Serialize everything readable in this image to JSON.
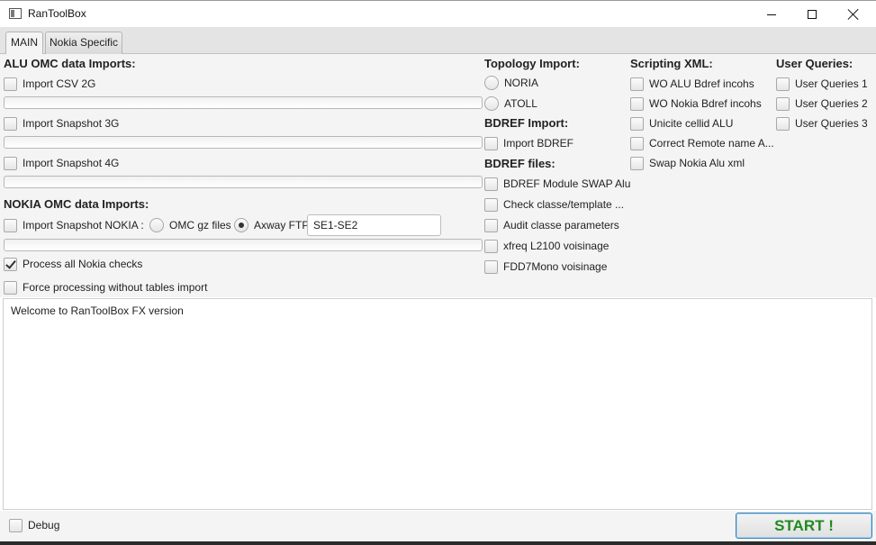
{
  "window": {
    "title": "RanToolBox"
  },
  "tabs": [
    {
      "label": "MAIN",
      "selected": true
    },
    {
      "label": "Nokia Specific",
      "selected": false
    }
  ],
  "alu": {
    "heading": "ALU OMC data Imports:",
    "items": [
      {
        "label": "Import CSV 2G",
        "checked": false,
        "progress": 0
      },
      {
        "label": "Import Snapshot 3G",
        "checked": false,
        "progress": 0
      },
      {
        "label": "Import Snapshot 4G",
        "checked": false,
        "progress": 0
      }
    ]
  },
  "nokia": {
    "heading": "NOKIA OMC data Imports:",
    "snapshot_label": "Import Snapshot NOKIA :",
    "snapshot_checked": false,
    "radio_omc_label": "OMC gz files",
    "radio_omc_selected": false,
    "radio_axway_label": "Axway FTP",
    "radio_axway_selected": true,
    "ftp_value": "SE1-SE2",
    "progress": 0,
    "process_all_label": "Process all Nokia checks",
    "process_all_checked": true,
    "force_label": "Force processing without tables import",
    "force_checked": false
  },
  "topology": {
    "heading": "Topology Import:",
    "options": [
      {
        "label": "NORIA",
        "selected": false
      },
      {
        "label": "ATOLL",
        "selected": false
      }
    ]
  },
  "bdref_import": {
    "heading": "BDREF Import:",
    "label": "Import BDREF",
    "checked": false
  },
  "bdref_files": {
    "heading": "BDREF files:",
    "items": [
      {
        "label": "BDREF Module SWAP Alu",
        "checked": false
      },
      {
        "label": "Check classe/template ...",
        "checked": false
      },
      {
        "label": "Audit classe parameters",
        "checked": false
      },
      {
        "label": "xfreq L2100 voisinage",
        "checked": false
      },
      {
        "label": "FDD7Mono voisinage",
        "checked": false
      }
    ]
  },
  "scripting": {
    "heading": "Scripting XML:",
    "items": [
      {
        "label": "WO ALU Bdref incohs",
        "checked": false
      },
      {
        "label": "WO Nokia Bdref incohs",
        "checked": false
      },
      {
        "label": "Unicite cellid ALU",
        "checked": false
      },
      {
        "label": "Correct Remote name A...",
        "checked": false
      },
      {
        "label": "Swap Nokia Alu xml",
        "checked": false
      }
    ]
  },
  "user_queries": {
    "heading": "User Queries:",
    "items": [
      {
        "label": "User Queries 1",
        "checked": false
      },
      {
        "label": "User Queries 2",
        "checked": false
      },
      {
        "label": "User Queries 3",
        "checked": false
      }
    ]
  },
  "log": {
    "text": "Welcome to RanToolBox FX version"
  },
  "footer": {
    "debug_label": "Debug",
    "debug_checked": false,
    "start_label": "START !"
  },
  "colors": {
    "start_text": "#1f8a1f",
    "progress_fill": "#0096c9"
  }
}
